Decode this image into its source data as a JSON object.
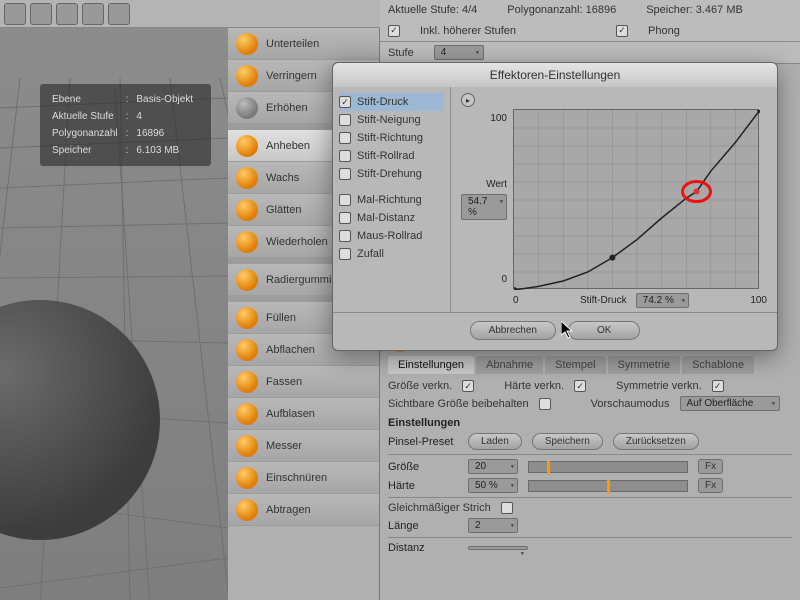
{
  "status": {
    "stufe_label": "Aktuelle Stufe:",
    "stufe_value": "4/4",
    "poly_label": "Polygonanzahl:",
    "poly_value": "16896",
    "mem_label": "Speicher:",
    "mem_value": "3.467 MB",
    "incl_label": "Inkl. höherer Stufen",
    "phong_label": "Phong",
    "stufe2_label": "Stufe",
    "stufe2_value": "4"
  },
  "hud": {
    "rows": [
      [
        "Ebene",
        "Basis-Objekt"
      ],
      [
        "Aktuelle Stufe",
        "4"
      ],
      [
        "Polygonanzahl",
        "16896"
      ],
      [
        "Speicher",
        "6.103 MB"
      ]
    ]
  },
  "palette": {
    "items": [
      {
        "label": "Unterteilen",
        "gray": false
      },
      {
        "label": "Verringern",
        "gray": false
      },
      {
        "label": "Erhöhen",
        "gray": true
      }
    ],
    "items2": [
      {
        "label": "Anheben",
        "sel": true
      },
      {
        "label": "Wachs"
      },
      {
        "label": "Glätten"
      },
      {
        "label": "Wiederholen"
      }
    ],
    "items3": [
      {
        "label": "Radiergummi"
      }
    ],
    "items4": [
      {
        "label": "Füllen"
      },
      {
        "label": "Abflachen"
      },
      {
        "label": "Fassen"
      },
      {
        "label": "Aufblasen"
      },
      {
        "label": "Messer"
      },
      {
        "label": "Einschnüren"
      },
      {
        "label": "Abtragen"
      }
    ]
  },
  "dialog": {
    "title": "Effektoren-Einstellungen",
    "effectors": [
      {
        "label": "Stift-Druck",
        "on": true,
        "sel": true
      },
      {
        "label": "Stift-Neigung",
        "on": false
      },
      {
        "label": "Stift-Richtung",
        "on": false
      },
      {
        "label": "Stift-Rollrad",
        "on": false
      },
      {
        "label": "Stift-Drehung",
        "on": false
      }
    ],
    "effectors2": [
      {
        "label": "Mal-Richtung",
        "on": false
      },
      {
        "label": "Mal-Distanz",
        "on": false
      },
      {
        "label": "Maus-Rollrad",
        "on": false
      },
      {
        "label": "Zufall",
        "on": false
      }
    ],
    "ylabel": "Wert",
    "yvalue": "54.7 %",
    "xlabel": "Stift-Druck",
    "xvalue": "74.2 %",
    "ymin": "0",
    "ymax": "100",
    "xmin": "0",
    "xmax": "100",
    "cancel": "Abbrechen",
    "ok": "OK"
  },
  "attr": {
    "tool": "Anheben",
    "tabs": [
      "Einstellungen",
      "Abnahme",
      "Stempel",
      "Symmetrie",
      "Schablone"
    ],
    "active_tab": 0,
    "link_size": "Größe verkn.",
    "link_hard": "Härte verkn.",
    "link_sym": "Symmetrie verkn.",
    "keep_size": "Sichtbare Größe beibehalten",
    "preview_label": "Vorschaumodus",
    "preview_value": "Auf Oberfläche",
    "settings": "Einstellungen",
    "preset_label": "Pinsel-Preset",
    "load": "Laden",
    "save": "Speichern",
    "reset": "Zurücksetzen",
    "size_label": "Größe",
    "size_value": "20",
    "hard_label": "Härte",
    "hard_value": "50 %",
    "evenstroke": "Gleichmäßiger Strich",
    "length_label": "Länge",
    "length_value": "2",
    "distance_label": "Distanz",
    "fx": "Fx"
  },
  "chart_data": {
    "type": "line",
    "title": "",
    "xlabel": "Stift-Druck",
    "ylabel": "Wert",
    "xlim": [
      0,
      100
    ],
    "ylim": [
      0,
      100
    ],
    "series": [
      {
        "name": "curve",
        "x": [
          0,
          10,
          20,
          30,
          40,
          50,
          60,
          70,
          74.2,
          80,
          90,
          100
        ],
        "y": [
          0,
          2,
          5,
          10,
          18,
          28,
          40,
          51,
          54.7,
          66,
          82,
          100
        ]
      }
    ],
    "highlight": {
      "x": 74.2,
      "y": 54.7
    }
  }
}
